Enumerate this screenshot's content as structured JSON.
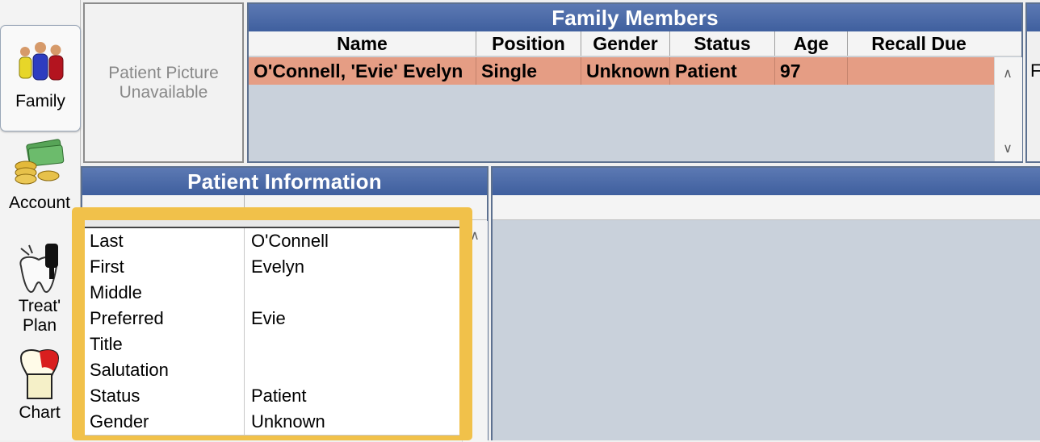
{
  "modules": {
    "family": {
      "label": "Family"
    },
    "account": {
      "label": "Account"
    },
    "treatplan": {
      "label_line1": "Treat'",
      "label_line2": "Plan"
    },
    "chart": {
      "label": "Chart"
    }
  },
  "picture": {
    "line1": "Patient Picture",
    "line2": "Unavailable"
  },
  "family_members": {
    "title": "Family Members",
    "columns": [
      "Name",
      "Position",
      "Gender",
      "Status",
      "Age",
      "Recall Due"
    ],
    "rows": [
      {
        "name": "O'Connell, 'Evie' Evelyn",
        "position": "Single",
        "gender": "Unknown",
        "status": "Patient",
        "age": "97",
        "recall_due": ""
      }
    ],
    "right_stub": "F"
  },
  "patient_info": {
    "title": "Patient Information",
    "fields": [
      {
        "label": "Last",
        "value": "O'Connell"
      },
      {
        "label": "First",
        "value": "Evelyn"
      },
      {
        "label": "Middle",
        "value": ""
      },
      {
        "label": "Preferred",
        "value": "Evie"
      },
      {
        "label": "Title",
        "value": ""
      },
      {
        "label": "Salutation",
        "value": ""
      },
      {
        "label": "Status",
        "value": "Patient"
      },
      {
        "label": "Gender",
        "value": "Unknown"
      }
    ]
  },
  "colors": {
    "title_bar": "#4a69a8",
    "selected_row": "#e59d84",
    "panel_bg": "#c9d1db",
    "highlight_border": "#f1c14a"
  }
}
